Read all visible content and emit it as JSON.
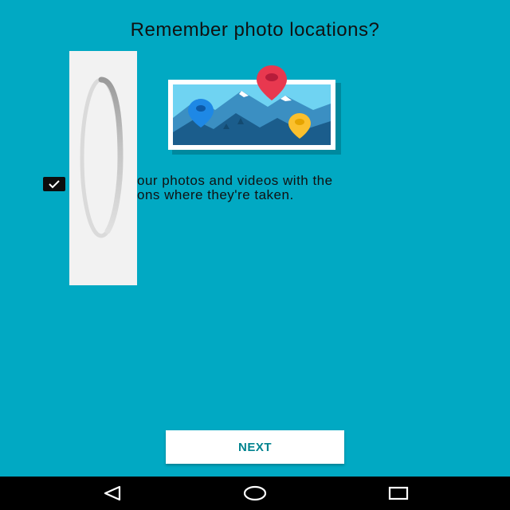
{
  "screen": {
    "title": "Remember photo locations?",
    "description_line1": "our photos and videos with the",
    "description_line2": "ons where they're taken.",
    "checkbox_checked": true,
    "next_label": "NEXT"
  },
  "colors": {
    "background": "#01a9c3",
    "accent_text": "#00838f",
    "pin_red": "#e8384f",
    "pin_blue": "#1e88e5",
    "pin_yellow": "#fbc02d"
  },
  "icons": {
    "checkbox": "check-icon",
    "illustration": "photo-map-pins-icon",
    "spinner": "loading-spinner-icon",
    "back": "back-triangle-icon",
    "home": "home-circle-icon",
    "recents": "recents-square-icon"
  }
}
